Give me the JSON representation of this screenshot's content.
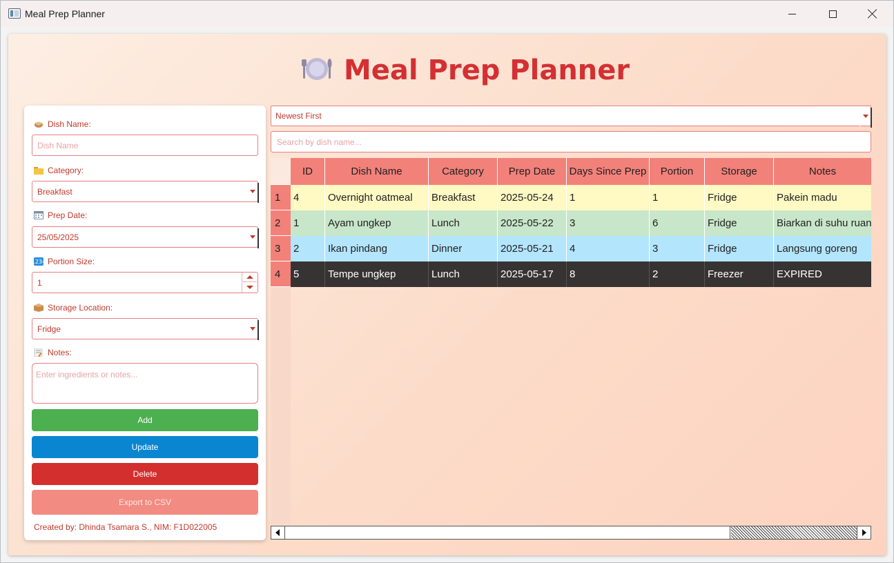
{
  "window": {
    "title": "Meal Prep Planner"
  },
  "header": {
    "title": "Meal Prep Planner",
    "icon": "plate-cutlery-icon"
  },
  "form": {
    "dish_name": {
      "label": "Dish Name:",
      "placeholder": "Dish Name",
      "value": ""
    },
    "category": {
      "label": "Category:",
      "value": "Breakfast"
    },
    "prep_date": {
      "label": "Prep Date:",
      "value": "25/05/2025"
    },
    "portion": {
      "label": "Portion Size:",
      "value": "1"
    },
    "storage": {
      "label": "Storage Location:",
      "value": "Fridge"
    },
    "notes": {
      "label": "Notes:",
      "placeholder": "Enter ingredients or notes..."
    },
    "buttons": {
      "add": "Add",
      "update": "Update",
      "delete": "Delete",
      "export": "Export to CSV"
    },
    "credit": "Created by: Dhinda Tsamara S., NIM: F1D022005"
  },
  "sort": {
    "value": "Newest First"
  },
  "search": {
    "placeholder": "Search by dish name..."
  },
  "table": {
    "columns": [
      "ID",
      "Dish Name",
      "Category",
      "Prep Date",
      "Days Since Prep",
      "Portion",
      "Storage",
      "Notes"
    ],
    "rows": [
      {
        "num": "1",
        "cells": [
          "4",
          "Overnight oatmeal",
          "Breakfast",
          "2025-05-24",
          "1",
          "1",
          "Fridge",
          "Pakein madu"
        ]
      },
      {
        "num": "2",
        "cells": [
          "1",
          "Ayam ungkep",
          "Lunch",
          "2025-05-22",
          "3",
          "6",
          "Fridge",
          "Biarkan di suhu ruan..."
        ]
      },
      {
        "num": "3",
        "cells": [
          "2",
          "Ikan pindang",
          "Dinner",
          "2025-05-21",
          "4",
          "3",
          "Fridge",
          "Langsung goreng"
        ]
      },
      {
        "num": "4",
        "cells": [
          "5",
          "Tempe ungkep",
          "Lunch",
          "2025-05-17",
          "8",
          "2",
          "Freezer",
          "EXPIRED"
        ]
      }
    ]
  },
  "colors": {
    "accent": "#d33033",
    "header_bg": "#f2817a",
    "row_fresh": "#fff9c4",
    "row_ok": "#c8e6c9",
    "row_aging": "#b3e5fc",
    "row_expired": "#373333",
    "btn_add": "#4caf50",
    "btn_update": "#0a86d0",
    "btn_delete": "#d32f2f",
    "btn_export": "#f28b82"
  }
}
